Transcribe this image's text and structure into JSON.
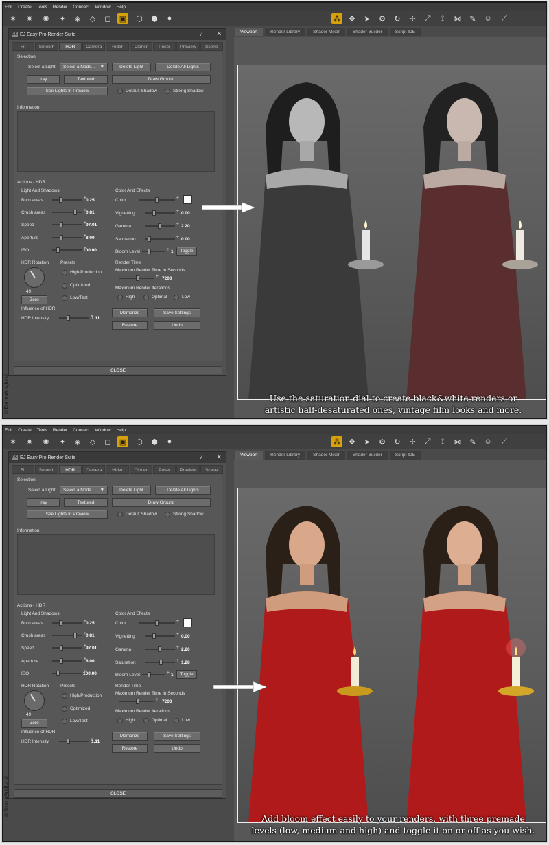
{
  "menu": [
    "Edit",
    "Create",
    "Tools",
    "Render",
    "Connect",
    "Window",
    "Help"
  ],
  "dialog": {
    "title": "EJ Easy Pro Render Suite",
    "help": "?",
    "close_x": "✕",
    "logo": "DS",
    "tabs": [
      "Fit",
      "Smooth",
      "HDR",
      "Camera",
      "Hider",
      "Cloner",
      "Poser",
      "Preview",
      "Scene"
    ],
    "active_tab": "HDR",
    "selection": {
      "heading": "Selection",
      "select_light": "Select a Light",
      "select_node": "Select a Node...",
      "delete_light": "Delete Light",
      "delete_all": "Delete All Lights",
      "iray": "Iray",
      "textured": "Textured",
      "draw_ground": "Draw Ground",
      "see_lights": "See Lights In Preview",
      "default_shadow": "Default Shadow",
      "strong_shadow": "Strong Shadow"
    },
    "information": "Information",
    "actions_heading": "Actions - HDR",
    "light_shadows": "Light And Shadows",
    "color_effects": "Color And Effects",
    "left_params": [
      {
        "label": "Burn areas",
        "value": "0.25",
        "pos": 0.25
      },
      {
        "label": "Crush areas",
        "value": "0.81",
        "pos": 0.81
      },
      {
        "label": "Speed",
        "value": "97.01",
        "pos": 0.3
      },
      {
        "label": "Aperture",
        "value": "8.00",
        "pos": 0.3
      },
      {
        "label": "ISO",
        "value": "100.00",
        "pos": 0.15
      }
    ],
    "color_label": "Color",
    "vignetting": {
      "label": "Vignetting",
      "value": "0.00",
      "pos": 0.3
    },
    "gamma": {
      "label": "Gamma",
      "value": "2.20",
      "pos": 0.5
    },
    "saturation_label": "Saturation",
    "bloom_label": "Bloom Level",
    "bloom_value": "1",
    "toggle": "Toggle",
    "hdr_rotation": "HDR Rotation",
    "rotation_value": "49",
    "zero": "Zero",
    "presets": "Presets",
    "preset_high": "High/Production",
    "preset_opt": "Optimized",
    "preset_low": "Low/Test",
    "render_time": "Render Time",
    "max_time": "Maximum Render Time In Seconds",
    "time_value": "7200",
    "max_iter": "Maximum Render Iterations",
    "iter_high": "High",
    "iter_opt": "Optimal",
    "iter_low": "Low",
    "influence": "Influence of HDR",
    "intensity_label": "HDR Intensity",
    "intensity_value": "1.11",
    "memorize": "Memorize",
    "save_settings": "Save Settings",
    "restore": "Restore",
    "undo": "Undo",
    "close_button": "CLOSE"
  },
  "viewport_tabs": [
    "Viewport",
    "Render Library",
    "Shader Mixer",
    "Shader Builder",
    "Script IDE"
  ],
  "panels": [
    {
      "saturation_value": "0.00",
      "saturation_pos": 0.1,
      "caption_line1": "Use the saturation dial to create black&white renders or",
      "caption_line2": "artistic half-desaturated ones, vintage film looks and more.",
      "left_color": "#3a3a3a",
      "right_color": "#5a2e2e"
    },
    {
      "saturation_value": "1.28",
      "saturation_pos": 0.55,
      "caption_line1": "Add bloom effect easily to your renders, with three premade",
      "caption_line2": "levels (low, medium and high) and toggle it on or off as you wish.",
      "left_color": "#b01a1a",
      "right_color": "#b01a1a"
    }
  ],
  "watermark": "©EmmaAndJordi",
  "colors": {
    "toolbar_active": "#d6a10a",
    "frame": "#f0f0f0"
  }
}
